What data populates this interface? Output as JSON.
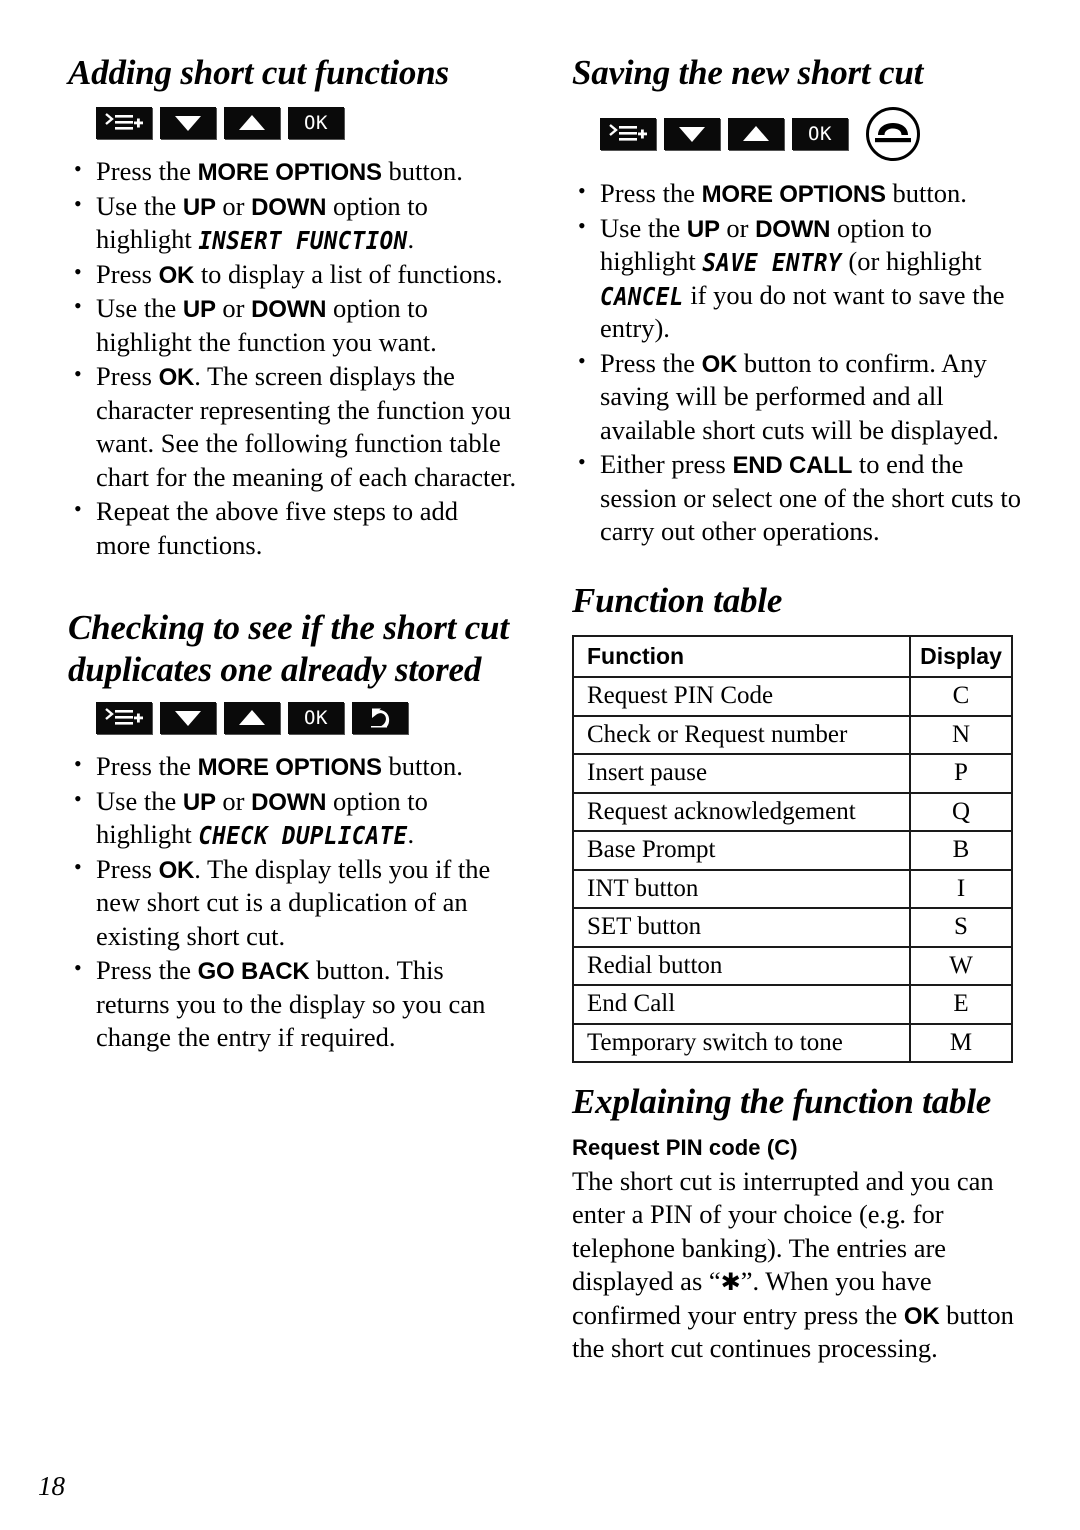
{
  "page_number": "18",
  "left_column": {
    "section1": {
      "heading": "Adding short cut functions",
      "keys": [
        {
          "icon": "more-options-icon",
          "label": ""
        },
        {
          "icon": "down-arrow-icon",
          "label": ""
        },
        {
          "icon": "up-arrow-icon",
          "label": ""
        },
        {
          "icon": "ok-key-icon",
          "label": "OK"
        }
      ],
      "steps": [
        {
          "id": "s1",
          "parts": [
            {
              "t": "Press the ",
              "s": "normal"
            },
            {
              "t": "MORE OPTIONS",
              "s": "bold"
            },
            {
              "t": " button.",
              "s": "normal"
            }
          ]
        },
        {
          "id": "s2",
          "parts": [
            {
              "t": "Use the ",
              "s": "normal"
            },
            {
              "t": "UP",
              "s": "bold"
            },
            {
              "t": " or ",
              "s": "normal"
            },
            {
              "t": "DOWN",
              "s": "bold"
            },
            {
              "t": " option to highlight ",
              "s": "normal"
            },
            {
              "t": "INSERT FUNCTION",
              "s": "lcd"
            },
            {
              "t": ".",
              "s": "normal"
            }
          ]
        },
        {
          "id": "s3",
          "parts": [
            {
              "t": "Press ",
              "s": "normal"
            },
            {
              "t": "OK",
              "s": "bold"
            },
            {
              "t": " to display a list of functions.",
              "s": "normal"
            }
          ]
        },
        {
          "id": "s4",
          "parts": [
            {
              "t": "Use the ",
              "s": "normal"
            },
            {
              "t": "UP",
              "s": "bold"
            },
            {
              "t": " or ",
              "s": "normal"
            },
            {
              "t": "DOWN",
              "s": "bold"
            },
            {
              "t": " option to highlight the function you want.",
              "s": "normal"
            }
          ]
        },
        {
          "id": "s5",
          "parts": [
            {
              "t": "Press ",
              "s": "normal"
            },
            {
              "t": "OK",
              "s": "bold"
            },
            {
              "t": ". The screen displays the character representing the function you want. See the following function table chart for the meaning of each character.",
              "s": "normal"
            }
          ]
        },
        {
          "id": "s6",
          "parts": [
            {
              "t": "Repeat the above five steps to add more functions.",
              "s": "normal"
            }
          ]
        }
      ]
    },
    "section2": {
      "heading": "Checking to see if the short cut duplicates one already stored",
      "keys": [
        {
          "icon": "more-options-icon",
          "label": ""
        },
        {
          "icon": "down-arrow-icon",
          "label": ""
        },
        {
          "icon": "up-arrow-icon",
          "label": ""
        },
        {
          "icon": "ok-key-icon",
          "label": "OK"
        },
        {
          "icon": "go-back-icon",
          "label": ""
        }
      ],
      "steps": [
        {
          "id": "d1",
          "parts": [
            {
              "t": "Press the ",
              "s": "normal"
            },
            {
              "t": "MORE OPTIONS",
              "s": "bold"
            },
            {
              "t": " button.",
              "s": "normal"
            }
          ]
        },
        {
          "id": "d2",
          "parts": [
            {
              "t": "Use the ",
              "s": "normal"
            },
            {
              "t": "UP",
              "s": "bold"
            },
            {
              "t": " or ",
              "s": "normal"
            },
            {
              "t": "DOWN",
              "s": "bold"
            },
            {
              "t": " option to highlight ",
              "s": "normal"
            },
            {
              "t": "CHECK DUPLICATE",
              "s": "lcd"
            },
            {
              "t": ".",
              "s": "normal"
            }
          ]
        },
        {
          "id": "d3",
          "parts": [
            {
              "t": "Press ",
              "s": "normal"
            },
            {
              "t": "OK",
              "s": "bold"
            },
            {
              "t": ". The display tells you if the new short cut is a duplication of an existing short cut.",
              "s": "normal"
            }
          ]
        },
        {
          "id": "d4",
          "parts": [
            {
              "t": "Press the ",
              "s": "normal"
            },
            {
              "t": "GO BACK",
              "s": "bold"
            },
            {
              "t": " button. This returns you to the display so you can change the entry if required.",
              "s": "normal"
            }
          ]
        }
      ]
    }
  },
  "right_column": {
    "section1": {
      "heading": "Saving the new short cut",
      "keys": [
        {
          "icon": "more-options-icon",
          "label": ""
        },
        {
          "icon": "down-arrow-icon",
          "label": ""
        },
        {
          "icon": "up-arrow-icon",
          "label": ""
        },
        {
          "icon": "ok-key-icon",
          "label": "OK"
        },
        {
          "icon": "end-call-icon",
          "label": ""
        }
      ],
      "steps": [
        {
          "id": "r1",
          "parts": [
            {
              "t": "Press the ",
              "s": "normal"
            },
            {
              "t": "MORE OPTIONS",
              "s": "bold"
            },
            {
              "t": " button.",
              "s": "normal"
            }
          ]
        },
        {
          "id": "r2",
          "parts": [
            {
              "t": "Use the ",
              "s": "normal"
            },
            {
              "t": "UP",
              "s": "bold"
            },
            {
              "t": " or ",
              "s": "normal"
            },
            {
              "t": "DOWN",
              "s": "bold"
            },
            {
              "t": " option to highlight ",
              "s": "normal"
            },
            {
              "t": "SAVE ENTRY",
              "s": "lcd"
            },
            {
              "t": " (or highlight ",
              "s": "normal"
            },
            {
              "t": "CANCEL",
              "s": "lcd"
            },
            {
              "t": " if you do not want to save the entry).",
              "s": "normal"
            }
          ]
        },
        {
          "id": "r3",
          "parts": [
            {
              "t": "Press the ",
              "s": "normal"
            },
            {
              "t": "OK",
              "s": "bold"
            },
            {
              "t": " button to confirm. Any saving will be performed and all available short cuts will be displayed.",
              "s": "normal"
            }
          ]
        },
        {
          "id": "r4",
          "parts": [
            {
              "t": "Either press ",
              "s": "normal"
            },
            {
              "t": "END CALL",
              "s": "bold"
            },
            {
              "t": " to end the session or select one of the short cuts to carry out other operations.",
              "s": "normal"
            }
          ]
        }
      ]
    },
    "function_table": {
      "heading": "Function table",
      "columns": [
        "Function",
        "Display"
      ],
      "rows": [
        [
          "Request PIN Code",
          "C"
        ],
        [
          "Check or Request number",
          "N"
        ],
        [
          "Insert pause",
          "P"
        ],
        [
          "Request acknowledgement",
          "Q"
        ],
        [
          "Base Prompt",
          "B"
        ],
        [
          "INT button",
          "I"
        ],
        [
          "SET button",
          "S"
        ],
        [
          "Redial button",
          "W"
        ],
        [
          "End Call",
          "E"
        ],
        [
          "Temporary switch to tone",
          "M"
        ]
      ]
    },
    "explaining": {
      "heading": "Explaining the function table",
      "subheading": "Request PIN code (C)",
      "paragraph_parts": [
        {
          "t": "The short cut is interrupted and you can enter a PIN of your choice (e.g. for telephone banking). The entries are displayed as “",
          "s": "normal"
        },
        {
          "t": "✱",
          "s": "asterisk"
        },
        {
          "t": "”. When you have confirmed your entry press the ",
          "s": "normal"
        },
        {
          "t": "OK",
          "s": "bold"
        },
        {
          "t": " button the short cut continues processing.",
          "s": "normal"
        }
      ]
    }
  }
}
